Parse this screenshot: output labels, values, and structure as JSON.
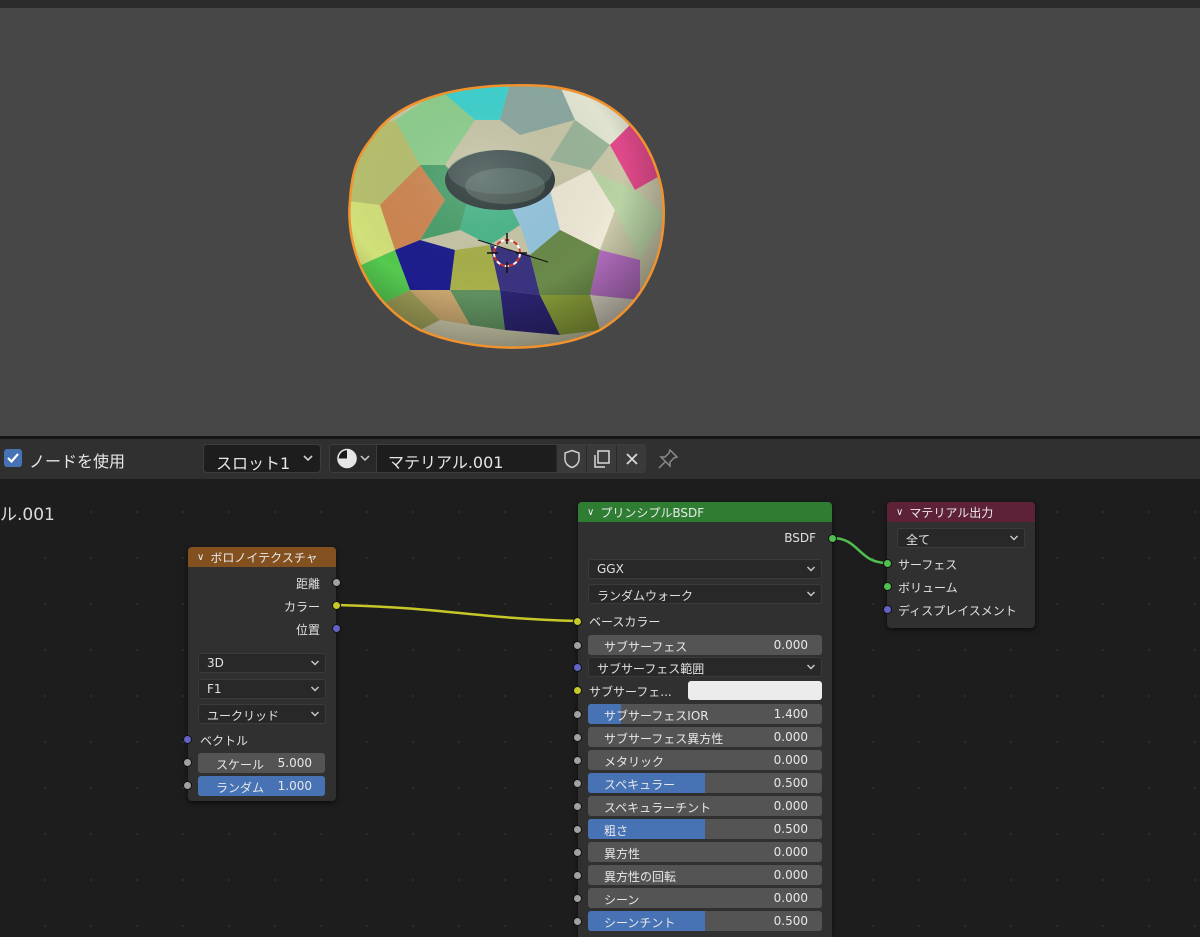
{
  "header": {
    "use_nodes_label": "ノードを使用",
    "slot_label": "スロット1",
    "material_name": "マテリアル.001"
  },
  "editor": {
    "partial_name": "ル.001"
  },
  "voronoi": {
    "title": "ボロノイテクスチャ",
    "outputs": [
      "距離",
      "カラー",
      "位置"
    ],
    "dims": "3D",
    "feature": "F1",
    "metric": "ユークリッド",
    "vector_label": "ベクトル",
    "scale_label": "スケール",
    "scale_value": "5.000",
    "random_label": "ランダム",
    "random_value": "1.000"
  },
  "bsdf": {
    "title": "プリンシプルBSDF",
    "output": "BSDF",
    "distribution": "GGX",
    "sss_method": "ランダムウォーク",
    "base_color_label": "ベースカラー",
    "sss_radius_label": "サブサーフェス範囲",
    "sss_color_label": "サブサーフェ...",
    "rows": [
      {
        "label": "サブサーフェス",
        "value": "0.000",
        "fill": 0.0
      },
      {
        "label": "サブサーフェスIOR",
        "value": "1.400",
        "fill": 0.14
      },
      {
        "label": "サブサーフェス異方性",
        "value": "0.000",
        "fill": 0.0
      },
      {
        "label": "メタリック",
        "value": "0.000",
        "fill": 0.0
      },
      {
        "label": "スペキュラー",
        "value": "0.500",
        "fill": 0.5
      },
      {
        "label": "スペキュラーチント",
        "value": "0.000",
        "fill": 0.0
      },
      {
        "label": "粗さ",
        "value": "0.500",
        "fill": 0.5
      },
      {
        "label": "異方性",
        "value": "0.000",
        "fill": 0.0
      },
      {
        "label": "異方性の回転",
        "value": "0.000",
        "fill": 0.0
      },
      {
        "label": "シーン",
        "value": "0.000",
        "fill": 0.0
      },
      {
        "label": "シーンチント",
        "value": "0.500",
        "fill": 0.5
      }
    ]
  },
  "output_node": {
    "title": "マテリアル出力",
    "target": "全て",
    "inputs": [
      "サーフェス",
      "ボリューム",
      "ディスプレイスメント"
    ]
  },
  "colors": {
    "voronoi_header": "#83501f",
    "bsdf_header": "#2e7d32",
    "output_header": "#5e2238",
    "accent": "#4772b3",
    "selection_outline": "#f0922e"
  }
}
